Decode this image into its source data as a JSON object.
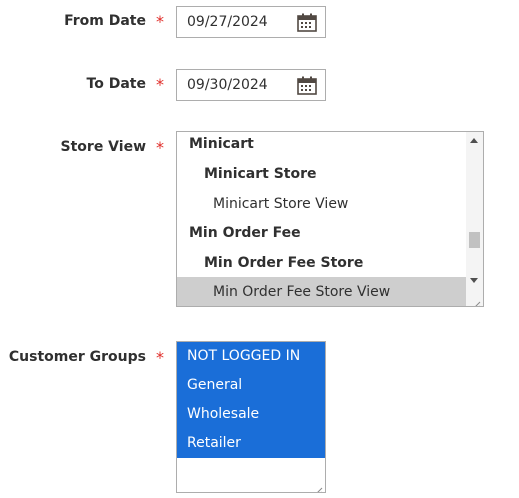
{
  "form": {
    "from_date": {
      "label": "From Date",
      "required_mark": "*",
      "value": "09/27/2024",
      "icon": "calendar-icon"
    },
    "to_date": {
      "label": "To Date",
      "required_mark": "*",
      "value": "09/30/2024",
      "icon": "calendar-icon"
    },
    "store_view": {
      "label": "Store View",
      "required_mark": "*",
      "options": [
        {
          "label": "Minicart",
          "level": 0,
          "selected": false
        },
        {
          "label": "Minicart Store",
          "level": 1,
          "selected": false
        },
        {
          "label": "Minicart Store View",
          "level": 2,
          "selected": false
        },
        {
          "label": "Min Order Fee",
          "level": 0,
          "selected": false
        },
        {
          "label": "Min Order Fee Store",
          "level": 1,
          "selected": false
        },
        {
          "label": "Min Order Fee Store View",
          "level": 2,
          "selected": true
        }
      ]
    },
    "customer_groups": {
      "label": "Customer Groups",
      "required_mark": "*",
      "options": [
        {
          "label": "NOT LOGGED IN",
          "selected": true
        },
        {
          "label": "General",
          "selected": true
        },
        {
          "label": "Wholesale",
          "selected": true
        },
        {
          "label": "Retailer",
          "selected": true
        }
      ]
    }
  },
  "colors": {
    "required": "#e02b27",
    "selected_blue": "#1a6ed8",
    "selected_gray": "#cecece",
    "border": "#adadad"
  }
}
